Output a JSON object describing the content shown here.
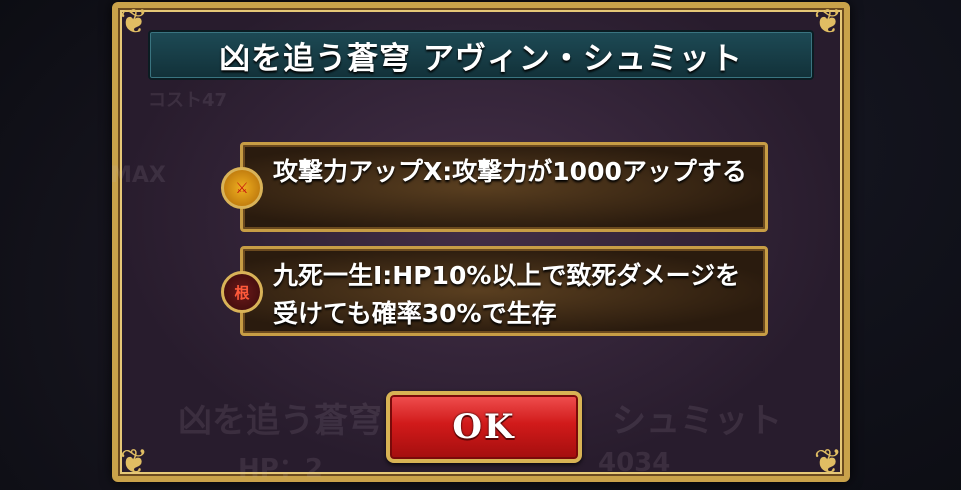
{
  "dialog": {
    "title": "凶を追う蒼穹 アヴィン・シュミット",
    "skills": [
      {
        "icon": "attack-up-icon",
        "icon_glyph": "⚔",
        "text": "攻撃力アップX:攻撃力が1000アップする"
      },
      {
        "icon": "guts-icon",
        "icon_glyph": "根",
        "text": "九死一生I:HP10%以上で致死ダメージを受けても確率30%で生存"
      }
    ],
    "ok_label": "OK"
  },
  "background": {
    "cost": "コスト47",
    "max": "MAX",
    "name": "凶を追う蒼穹",
    "name_suffix": "シュミット",
    "hp": "HP：2",
    "stat": "4034"
  }
}
